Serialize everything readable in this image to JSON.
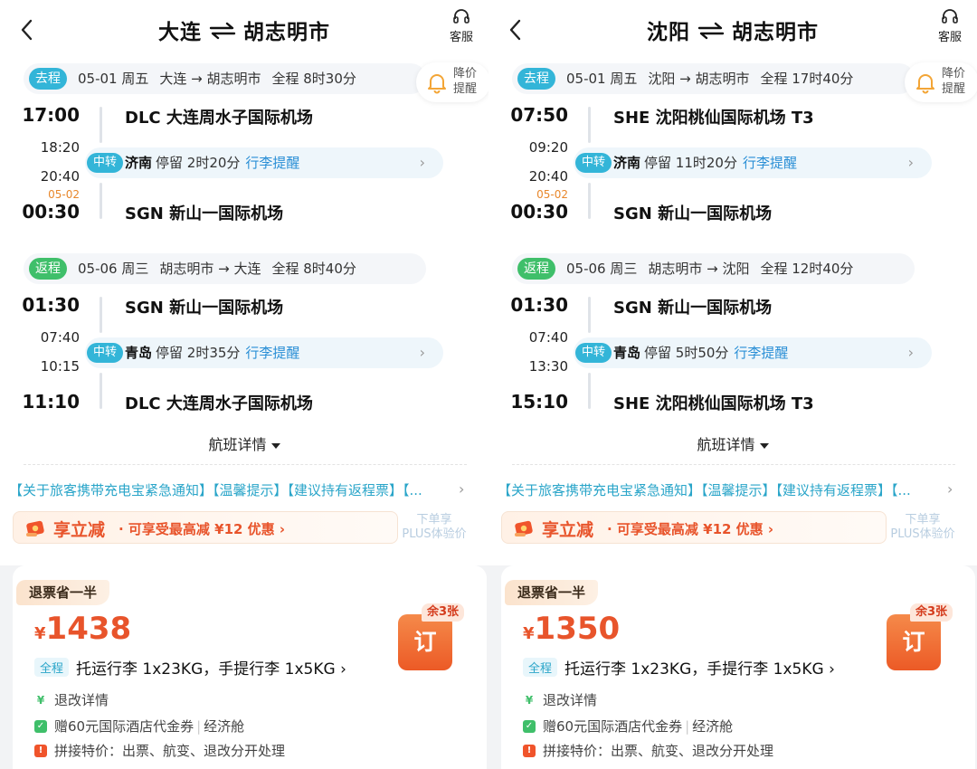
{
  "panels": [
    {
      "title_from": "大连",
      "title_to": "胡志明市",
      "service_label": "客服",
      "outbound": {
        "tag": "去程",
        "date": "05-01 周五",
        "route": "大连 → 胡志明市",
        "total": "全程 8时30分",
        "dep_time": "17:00",
        "dep_airport": "DLC 大连周水子国际机场",
        "arr1_time": "18:20",
        "dep2_time": "20:40",
        "arr_date": "05-02",
        "arr_time": "00:30",
        "arr_airport": "SGN 新山一国际机场",
        "transfer_tag": "中转",
        "transfer_city": "济南",
        "transfer_stay": "停留 2时20分",
        "transfer_link": "行李提醒"
      },
      "ret": {
        "tag": "返程",
        "date": "05-06 周三",
        "route": "胡志明市 → 大连",
        "total": "全程 8时40分",
        "dep_time": "01:30",
        "dep_airport": "SGN 新山一国际机场",
        "arr1_time": "07:40",
        "dep2_time": "10:15",
        "arr_time": "11:10",
        "arr_airport": "DLC 大连周水子国际机场",
        "transfer_tag": "中转",
        "transfer_city": "青岛",
        "transfer_stay": "停留 2时35分",
        "transfer_link": "行李提醒"
      },
      "price_alert": "降价提醒",
      "flight_details": "航班详情",
      "notice": "【关于旅客携带充电宝紧急通知】【温馨提示】【建议持有返程票】【...",
      "promo_big": "享立减",
      "promo_small": "· 可享受最高减 ¥12 优惠  ›",
      "plus_line1": "下单享",
      "plus_line2": "PLUS体验价",
      "refund_badge": "退票省一半",
      "currency": "¥",
      "price": "1438",
      "remaining": "余3张",
      "book_label": "订",
      "fare_scope": "全程",
      "baggage": "托运行李 1x23KG，手提行李 1x5KG ›",
      "rule1": "退改详情",
      "rule2a": "赠60元国际酒店代金券",
      "rule2b": "经济舱",
      "rule3": "拼接特价：出票、航变、退改分开处理"
    },
    {
      "title_from": "沈阳",
      "title_to": "胡志明市",
      "service_label": "客服",
      "outbound": {
        "tag": "去程",
        "date": "05-01 周五",
        "route": "沈阳 → 胡志明市",
        "total": "全程 17时40分",
        "dep_time": "07:50",
        "dep_airport": "SHE 沈阳桃仙国际机场 T3",
        "arr1_time": "09:20",
        "dep2_time": "20:40",
        "arr_date": "05-02",
        "arr_time": "00:30",
        "arr_airport": "SGN 新山一国际机场",
        "transfer_tag": "中转",
        "transfer_city": "济南",
        "transfer_stay": "停留 11时20分",
        "transfer_link": "行李提醒"
      },
      "ret": {
        "tag": "返程",
        "date": "05-06 周三",
        "route": "胡志明市 → 沈阳",
        "total": "全程 12时40分",
        "dep_time": "01:30",
        "dep_airport": "SGN 新山一国际机场",
        "arr1_time": "07:40",
        "dep2_time": "13:30",
        "arr_time": "15:10",
        "arr_airport": "SHE 沈阳桃仙国际机场 T3",
        "transfer_tag": "中转",
        "transfer_city": "青岛",
        "transfer_stay": "停留 5时50分",
        "transfer_link": "行李提醒"
      },
      "price_alert": "降价提醒",
      "flight_details": "航班详情",
      "notice": "【关于旅客携带充电宝紧急通知】【温馨提示】【建议持有返程票】【...",
      "promo_big": "享立减",
      "promo_small": "· 可享受最高减 ¥12 优惠  ›",
      "plus_line1": "下单享",
      "plus_line2": "PLUS体验价",
      "refund_badge": "退票省一半",
      "currency": "¥",
      "price": "1350",
      "remaining": "余3张",
      "book_label": "订",
      "fare_scope": "全程",
      "baggage": "托运行李 1x23KG，手提行李 1x5KG ›",
      "rule1": "退改详情",
      "rule2a": "赠60元国际酒店代金券",
      "rule2b": "经济舱",
      "rule3": "拼接特价：出票、航变、退改分开处理"
    }
  ],
  "colors": {
    "outbound_tag": "#33b5d8",
    "return_tag": "#3fbf6a",
    "price": "#e8542b",
    "link": "#2a8fd6"
  }
}
